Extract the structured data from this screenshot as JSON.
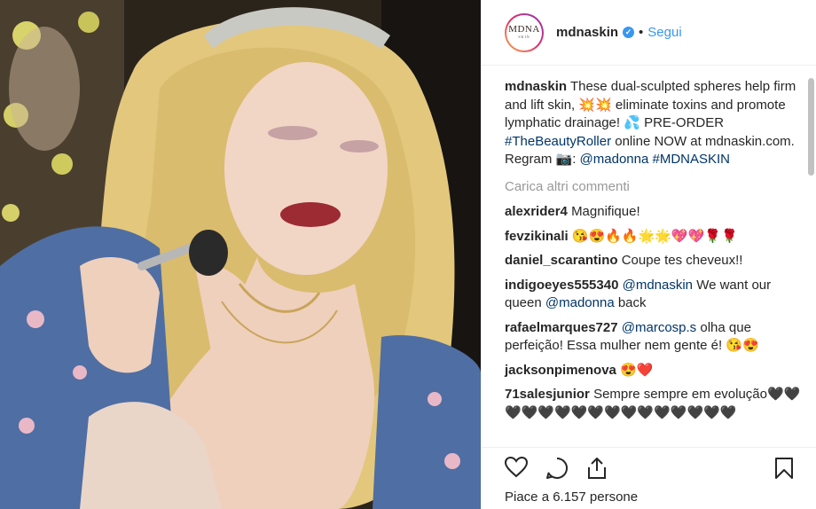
{
  "post": {
    "username": "mdnaskin",
    "follow_label": "Segui",
    "dot": "•",
    "avatar_logo": "MDNA",
    "avatar_sub": "SKIN"
  },
  "caption": {
    "user": "mdnaskin",
    "text1": "These dual-sculpted spheres help firm and lift skin, 💥💥 eliminate toxins and promote lymphatic drainage! 💦 PRE-ORDER ",
    "hashtag1": "#TheBeautyRoller",
    "text2": " online NOW at mdnaskin.com. Regram 📷: ",
    "mention": "@madonna",
    "text3": " ",
    "hashtag2": "#MDNASKIN"
  },
  "load_more": "Carica altri commenti",
  "comments": [
    {
      "user": "alexrider4",
      "text": "Magnifique!"
    },
    {
      "user": "fevzikinali",
      "text": "😘😍🔥🔥🌟🌟💖💖🌹🌹"
    },
    {
      "user": "daniel_scarantino",
      "text": "Coupe tes cheveux!!"
    },
    {
      "user": "indigoeyes555340",
      "mention": "@mdnaskin",
      "text": " We want our queen ",
      "mention2": "@madonna",
      "text2": " back"
    },
    {
      "user": "rafaelmarques727",
      "mention": "@marcosp.s",
      "text": " olha que perfeição! Essa mulher nem gente é! 😘😍"
    },
    {
      "user": "jacksonpimenova",
      "text": "😍❤️"
    },
    {
      "user": "71salesjunior",
      "text": "Sempre sempre em evolução🖤🖤🖤🖤🖤🖤🖤🖤🖤🖤🖤🖤🖤🖤🖤🖤"
    }
  ],
  "likes": "Piace a 6.157 persone",
  "colors": {
    "link": "#3897f0",
    "hashtag": "#003569",
    "muted": "#999999",
    "text": "#262626"
  },
  "icons": [
    "verified-badge-icon",
    "heart-icon",
    "comment-icon",
    "share-icon",
    "bookmark-icon"
  ]
}
